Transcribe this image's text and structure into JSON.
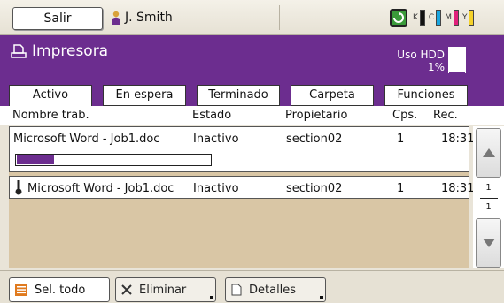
{
  "topbar": {
    "logout_label": "Salir",
    "user_name": "J. Smith",
    "toners": [
      {
        "label": "K",
        "color": "#111111"
      },
      {
        "label": "C",
        "color": "#1aa6e0"
      },
      {
        "label": "M",
        "color": "#e0207a"
      },
      {
        "label": "Y",
        "color": "#f5d22a"
      }
    ]
  },
  "header": {
    "title": "Impresora",
    "hdd_label": "Uso HDD",
    "hdd_value": "1%",
    "hdd_fraction": 0.01,
    "accent": "#6c2d8f"
  },
  "tabs": [
    {
      "label": "Activo"
    },
    {
      "label": "En espera"
    },
    {
      "label": "Terminado"
    },
    {
      "label": "Carpeta"
    },
    {
      "label": "Funciones"
    }
  ],
  "columns": {
    "name": "Nombre trab.",
    "status": "Estado",
    "owner": "Propietario",
    "copies": "Cps.",
    "received": "Rec."
  },
  "jobs": [
    {
      "name": "Microsoft Word - Job1.doc",
      "status": "Inactivo",
      "owner": "section02",
      "copies": "1",
      "received": "18:31",
      "progress": 0.2
    },
    {
      "name": "Microsoft Word - Job1.doc",
      "status": "Inactivo",
      "owner": "section02",
      "copies": "1",
      "received": "18:31"
    }
  ],
  "pager": {
    "current": "1",
    "total": "1"
  },
  "bottom": {
    "select_all": "Sel. todo",
    "delete": "Eliminar",
    "details": "Detalles"
  }
}
